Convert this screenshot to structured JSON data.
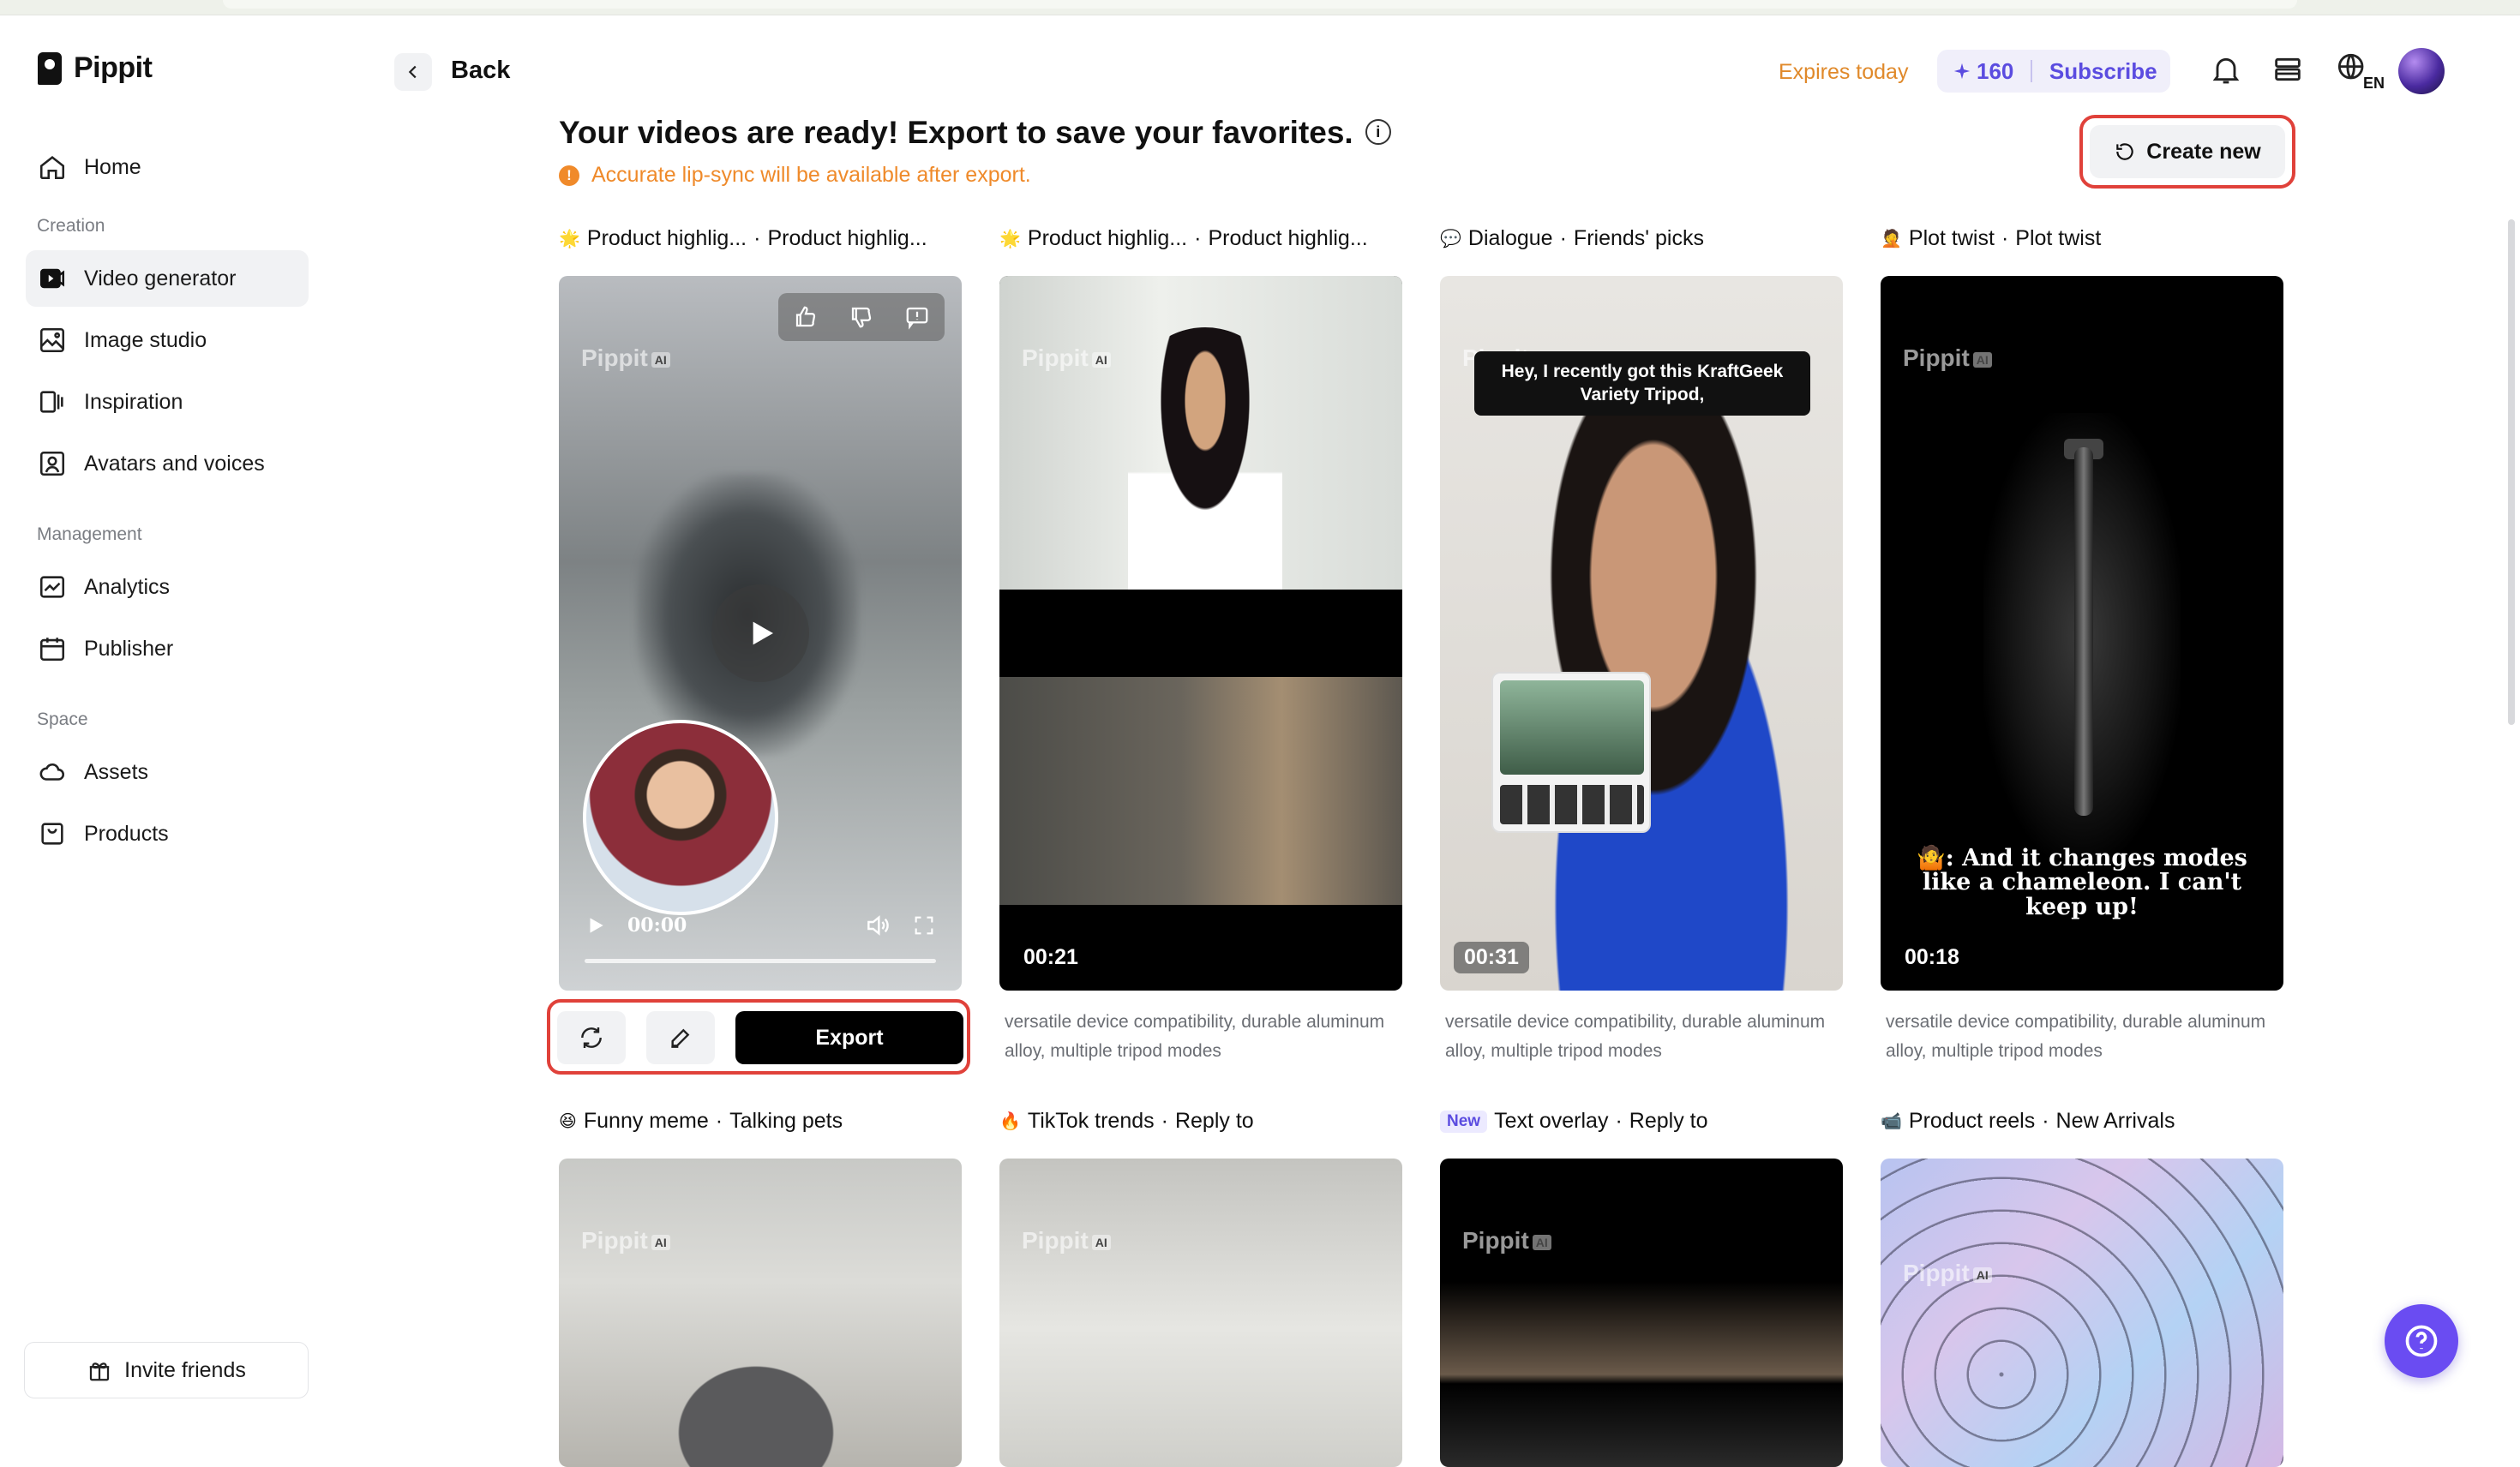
{
  "app": {
    "logo_text": "Pippit"
  },
  "sidebar": {
    "home": "Home",
    "section_creation": "Creation",
    "video_generator": "Video generator",
    "image_studio": "Image studio",
    "inspiration": "Inspiration",
    "avatars_voices": "Avatars and voices",
    "section_management": "Management",
    "analytics": "Analytics",
    "publisher": "Publisher",
    "section_space": "Space",
    "assets": "Assets",
    "products": "Products",
    "invite": "Invite friends",
    "active_item": "Video generator"
  },
  "header": {
    "back": "Back",
    "expires": "Expires today",
    "credits": "160",
    "subscribe": "Subscribe",
    "language": "EN"
  },
  "main": {
    "title": "Your videos are ready! Export to save your favorites.",
    "notice": "Accurate lip-sync will be available after export.",
    "create_new": "Create new",
    "watermark": "Pippit",
    "watermark_badge": "AI",
    "cards": [
      {
        "label_a": "Product highlig...",
        "label_b": "Product highlig...",
        "time": "00:00",
        "export": "Export"
      },
      {
        "label_a": "Product highlig...",
        "label_b": "Product highlig...",
        "duration": "00:21",
        "description": "versatile device compatibility, durable aluminum alloy, multiple tripod modes"
      },
      {
        "label_a": "Dialogue",
        "label_b": "Friends' picks",
        "duration": "00:31",
        "caption": "Hey, I recently got this KraftGeek Variety Tripod,",
        "description": "versatile device compatibility, durable aluminum alloy, multiple tripod modes"
      },
      {
        "label_a": "Plot twist",
        "label_b": "Plot twist",
        "duration": "00:18",
        "caption": ": And it changes modes like a chameleon. I can't keep up!",
        "description": "versatile device compatibility, durable aluminum alloy, multiple tripod modes"
      }
    ],
    "bottom_cards": [
      {
        "label_a": "Funny meme",
        "label_b": "Talking pets"
      },
      {
        "label_a": "TikTok trends",
        "label_b": "Reply to"
      },
      {
        "badge": "New",
        "label_a": "Text overlay",
        "label_b": "Reply to"
      },
      {
        "label_a": "Product reels",
        "label_b": "New Arrivals"
      }
    ]
  },
  "colors": {
    "accent_purple": "#6a4cf2",
    "expires_orange": "#e0892a",
    "highlight_red": "#e0413a"
  }
}
